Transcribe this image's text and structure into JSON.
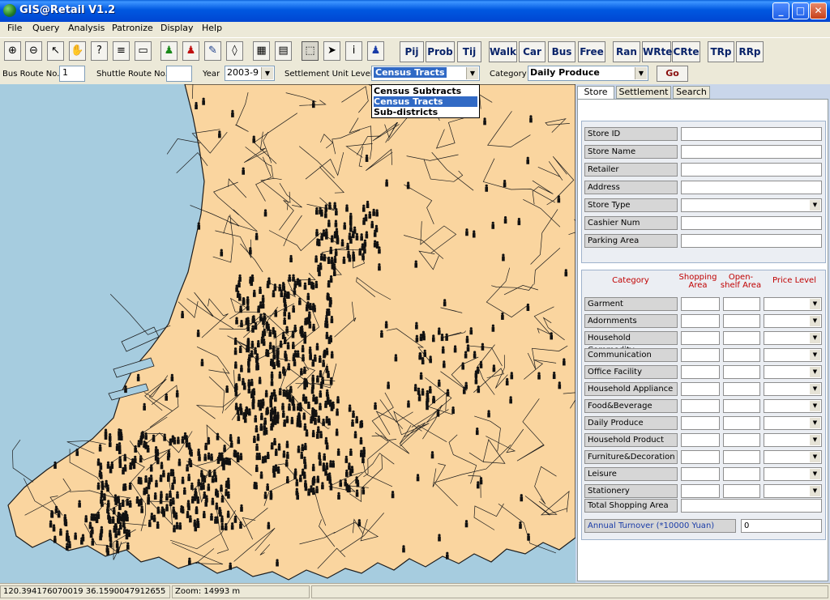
{
  "window": {
    "title": "GIS@Retail V1.2",
    "min": "_",
    "max": "□",
    "close": "✕"
  },
  "menu": [
    "File",
    "Query",
    "Analysis",
    "Patronize",
    "Display",
    "Help"
  ],
  "toolbar": {
    "tools": [
      "zoom-in",
      "zoom-out",
      "pointer",
      "pan",
      "help",
      "layers",
      "map",
      "person-green",
      "person-red",
      "pin",
      "eraser",
      "table",
      "report",
      "select",
      "arrow",
      "info",
      "person-blue"
    ],
    "text_buttons": [
      "Pij",
      "Prob",
      "Tij",
      "Walk",
      "Car",
      "Bus",
      "Free",
      "Ran",
      "WRte",
      "CRte",
      "TRp",
      "RRp"
    ]
  },
  "params": {
    "bus_route_label": "Bus Route No.",
    "bus_route_value": "1",
    "shuttle_route_label": "Shuttle Route No.",
    "shuttle_route_value": "",
    "year_label": "Year",
    "year_value": "2003-9",
    "settlement_label": "Settlement Unit Level",
    "settlement_value": "Census Tracts",
    "settlement_options": [
      "Census Subtracts",
      "Census Tracts",
      "Sub-districts"
    ],
    "category_label": "Category",
    "category_value": "Daily Produce",
    "go_label": "Go"
  },
  "tabs": [
    "Store",
    "Settlement",
    "Search"
  ],
  "store_fields": [
    "Store ID",
    "Store Name",
    "Retailer",
    "Address",
    "Store Type",
    "Cashier Num",
    "Parking Area"
  ],
  "category_table": {
    "headers": [
      "Category",
      "Shopping Area",
      "Open-shelf Area",
      "Price Level"
    ],
    "rows": [
      "Garment",
      "Adornments",
      "Household Commodity",
      "Communication",
      "Office Facility",
      "Household Appliance",
      "Food&Beverage",
      "Daily Produce",
      "Household Product",
      "Furniture&Decoration",
      "Leisure",
      "Stationery"
    ],
    "total_label": "Total Shopping Area",
    "turnover_label": "Annual Turnover (*10000 Yuan)",
    "turnover_value": "0"
  },
  "status": {
    "coords": "120.394176070019  36.1590047912655",
    "zoom": "Zoom:  14993 m"
  },
  "colors": {
    "land": "#fad59f",
    "sea": "#a6ccdf",
    "boundary": "#1c1c1c",
    "marker": "#111111",
    "accent": "#316ac5"
  }
}
